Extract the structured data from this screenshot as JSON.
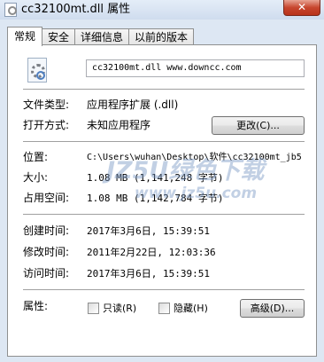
{
  "window": {
    "title": "cc32100mt.dll 属性",
    "close_glyph": "✕"
  },
  "tabs": [
    {
      "label": "常规"
    },
    {
      "label": "安全"
    },
    {
      "label": "详细信息"
    },
    {
      "label": "以前的版本"
    }
  ],
  "general": {
    "file_name": "cc32100mt.dll  www.downcc.com",
    "type_label": "文件类型:",
    "type_value": "应用程序扩展 (.dll)",
    "opens_label": "打开方式:",
    "opens_value": "未知应用程序",
    "change_button": "更改(C)...",
    "location_label": "位置:",
    "location_value": "C:\\Users\\wuhan\\Desktop\\软件\\cc32100mt_jb5",
    "size_label": "大小:",
    "size_value": "1.08 MB (1,141,248 字节)",
    "size_on_disk_label": "占用空间:",
    "size_on_disk_value": "1.08 MB (1,142,784 字节)",
    "created_label": "创建时间:",
    "created_value": "2017年3月6日, 15:39:51",
    "modified_label": "修改时间:",
    "modified_value": "2011年2月22日, 12:03:36",
    "accessed_label": "访问时间:",
    "accessed_value": "2017年3月6日, 15:39:51",
    "attributes_label": "属性:",
    "readonly_label": "只读(R)",
    "readonly_checked": false,
    "hidden_label": "隐藏(H)",
    "hidden_checked": false,
    "advanced_button": "高级(D)..."
  },
  "watermark": {
    "logo_text": "JZ5U绿色下载",
    "url_text": "www.jz5u.com"
  }
}
